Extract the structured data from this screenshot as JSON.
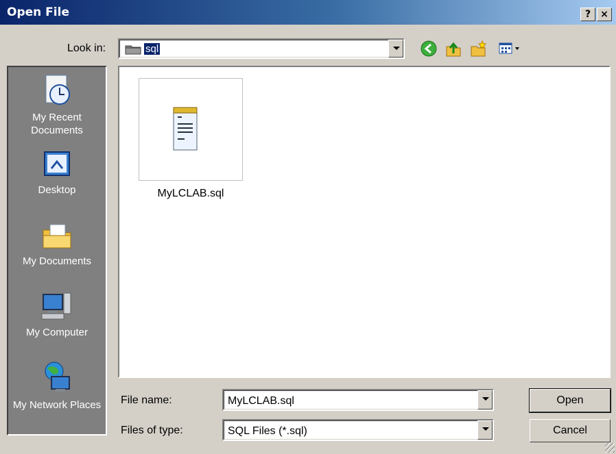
{
  "window": {
    "title": "Open File",
    "help_btn": "?",
    "close_btn": "×"
  },
  "toolbar": {
    "look_in_label": "Look in:",
    "look_in_value": "sql"
  },
  "places": [
    {
      "label": "My Recent Documents",
      "icon": "recent-documents-icon"
    },
    {
      "label": "Desktop",
      "icon": "desktop-icon"
    },
    {
      "label": "My Documents",
      "icon": "my-documents-icon"
    },
    {
      "label": "My Computer",
      "icon": "my-computer-icon"
    },
    {
      "label": "My Network Places",
      "icon": "network-places-icon"
    }
  ],
  "files": [
    {
      "name": "MyLCLAB.sql",
      "icon": "notepad-file-icon"
    }
  ],
  "form": {
    "file_name_label": "File name:",
    "file_name_value": "MyLCLAB.sql",
    "file_type_label": "Files of type:",
    "file_type_value": "SQL Files (*.sql)"
  },
  "buttons": {
    "open": "Open",
    "cancel": "Cancel"
  },
  "colors": {
    "titlebar_start": "#0a246a",
    "titlebar_end": "#a6caf0",
    "face": "#d4d0c8",
    "places_bg": "#808080"
  }
}
